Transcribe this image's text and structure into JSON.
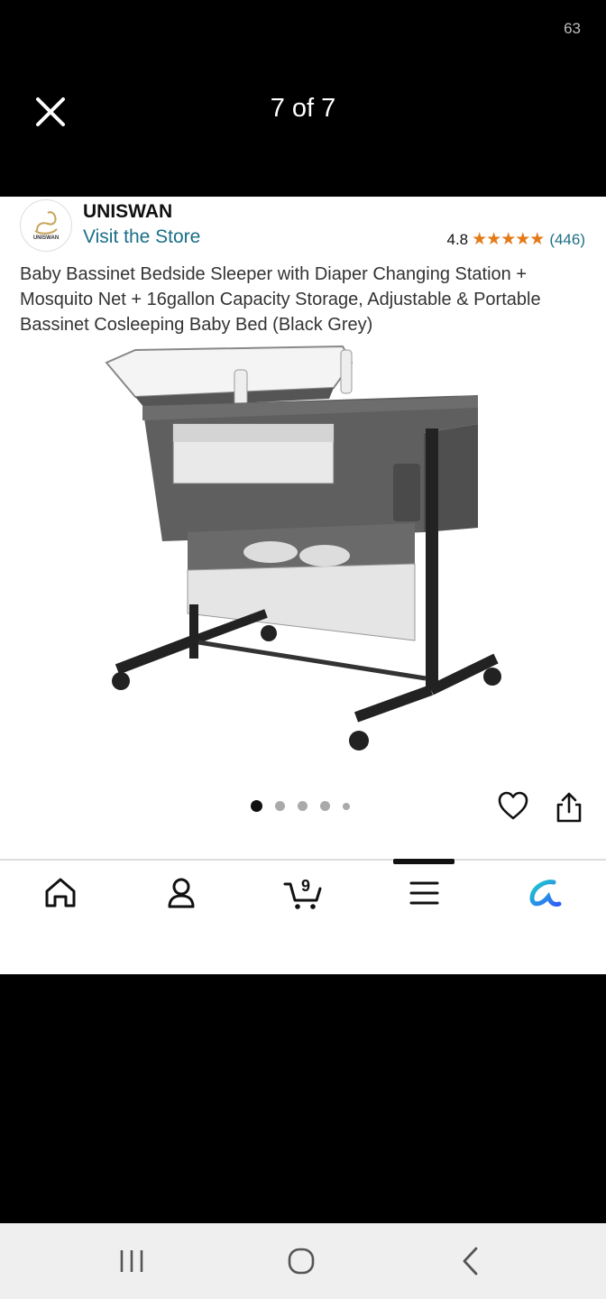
{
  "status_bar": {
    "number": "63"
  },
  "viewer": {
    "counter": "7 of 7"
  },
  "store": {
    "logo_text": "UNISWAN",
    "brand": "UNISWAN",
    "visit_label": "Visit the Store",
    "rating": "4.8",
    "stars": "★★★★★",
    "review_count": "(446)"
  },
  "product": {
    "title": "Baby Bassinet Bedside Sleeper with Diaper Changing Station + Mosquito Net + 16gallon Capacity Storage, Adjustable & Portable Bassinet Cosleeping Baby Bed (Black Grey)",
    "image_count": 5,
    "active_image_index": 0
  },
  "bottom_nav": {
    "cart_count": "9",
    "items": [
      "home-icon",
      "account-icon",
      "cart-icon",
      "menu-icon",
      "rufus-icon"
    ]
  },
  "colors": {
    "link": "#1a6e86",
    "star": "#e47a17",
    "rufus": "#2f8cff"
  }
}
